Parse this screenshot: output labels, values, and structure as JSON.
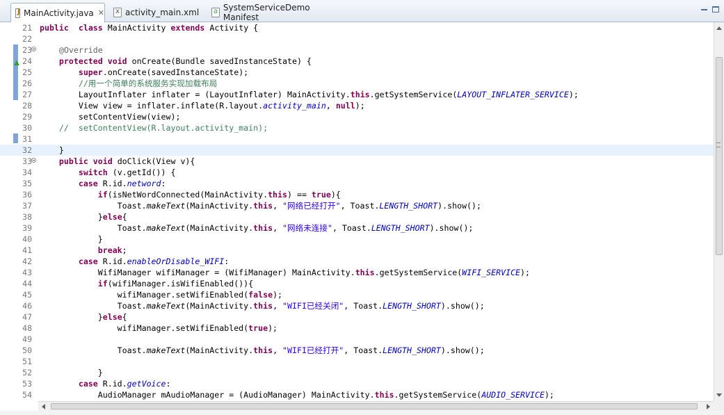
{
  "tabs": [
    {
      "label": "MainActivity.java",
      "icon": "java-file-icon",
      "active": true
    },
    {
      "label": "activity_main.xml",
      "icon": "xml-file-icon",
      "active": false
    },
    {
      "label": "SystemServiceDemo Manifest",
      "icon": "manifest-file-icon",
      "active": false
    }
  ],
  "editor": {
    "current_line": 32,
    "lines": [
      {
        "n": "21",
        "fold": false,
        "segments": [
          [
            "kw",
            "public"
          ],
          [
            "",
            "  "
          ],
          [
            "kw",
            "class"
          ],
          [
            "",
            " MainActivity "
          ],
          [
            "kw",
            "extends"
          ],
          [
            "",
            " Activity {"
          ]
        ]
      },
      {
        "n": "22",
        "fold": false,
        "segments": []
      },
      {
        "n": "23",
        "fold": true,
        "segments": [
          [
            "",
            "    "
          ],
          [
            "ann",
            "@Override"
          ]
        ]
      },
      {
        "n": "24",
        "fold": false,
        "segments": [
          [
            "",
            "    "
          ],
          [
            "kw",
            "protected"
          ],
          [
            "",
            " "
          ],
          [
            "kw",
            "void"
          ],
          [
            "",
            " onCreate(Bundle savedInstanceState) {"
          ]
        ]
      },
      {
        "n": "25",
        "fold": false,
        "segments": [
          [
            "",
            "        "
          ],
          [
            "kw",
            "super"
          ],
          [
            "",
            ".onCreate(savedInstanceState);"
          ]
        ]
      },
      {
        "n": "26",
        "fold": false,
        "segments": [
          [
            "",
            "        "
          ],
          [
            "cm",
            "//用一个简单的系统服务实现加载布局"
          ]
        ]
      },
      {
        "n": "27",
        "fold": false,
        "segments": [
          [
            "",
            "        LayoutInflater inflater = (LayoutInflater) MainActivity."
          ],
          [
            "kw",
            "this"
          ],
          [
            "",
            ".getSystemService("
          ],
          [
            "sf",
            "LAYOUT_INFLATER_SERVICE"
          ],
          [
            "",
            ");"
          ]
        ]
      },
      {
        "n": "28",
        "fold": false,
        "segments": [
          [
            "",
            "        View view = inflater.inflate(R.layout."
          ],
          [
            "sf",
            "activity_main"
          ],
          [
            "",
            ", "
          ],
          [
            "kw",
            "null"
          ],
          [
            "",
            ");"
          ]
        ]
      },
      {
        "n": "29",
        "fold": false,
        "segments": [
          [
            "",
            "        setContentView(view);"
          ]
        ]
      },
      {
        "n": "30",
        "fold": false,
        "segments": [
          [
            "cm",
            "    //  setContentView(R.layout.activity_main);"
          ]
        ]
      },
      {
        "n": "31",
        "fold": false,
        "segments": []
      },
      {
        "n": "32",
        "fold": false,
        "segments": [
          [
            "",
            "    }"
          ]
        ]
      },
      {
        "n": "33",
        "fold": true,
        "segments": [
          [
            "",
            "    "
          ],
          [
            "kw",
            "public"
          ],
          [
            "",
            " "
          ],
          [
            "kw",
            "void"
          ],
          [
            "",
            " doClick(View v){"
          ]
        ]
      },
      {
        "n": "34",
        "fold": false,
        "segments": [
          [
            "",
            "        "
          ],
          [
            "kw",
            "switch"
          ],
          [
            "",
            " (v.getId()) {"
          ]
        ]
      },
      {
        "n": "35",
        "fold": false,
        "segments": [
          [
            "",
            "        "
          ],
          [
            "kw",
            "case"
          ],
          [
            "",
            " R.id."
          ],
          [
            "sf",
            "netword"
          ],
          [
            "",
            ":"
          ]
        ]
      },
      {
        "n": "36",
        "fold": false,
        "segments": [
          [
            "",
            "            "
          ],
          [
            "kw",
            "if"
          ],
          [
            "",
            "(isNetWordConnected(MainActivity."
          ],
          [
            "kw",
            "this"
          ],
          [
            "",
            ") == "
          ],
          [
            "kw",
            "true"
          ],
          [
            "",
            "){"
          ]
        ]
      },
      {
        "n": "37",
        "fold": false,
        "segments": [
          [
            "",
            "                Toast."
          ],
          [
            "it",
            "makeText"
          ],
          [
            "",
            "(MainActivity."
          ],
          [
            "kw",
            "this"
          ],
          [
            "",
            ", "
          ],
          [
            "st",
            "\"网络已经打开\""
          ],
          [
            "",
            ", Toast."
          ],
          [
            "sf",
            "LENGTH_SHORT"
          ],
          [
            "",
            ").show();"
          ]
        ]
      },
      {
        "n": "38",
        "fold": false,
        "segments": [
          [
            "",
            "            }"
          ],
          [
            "kw",
            "else"
          ],
          [
            "",
            "{"
          ]
        ]
      },
      {
        "n": "39",
        "fold": false,
        "segments": [
          [
            "",
            "                Toast."
          ],
          [
            "it",
            "makeText"
          ],
          [
            "",
            "(MainActivity."
          ],
          [
            "kw",
            "this"
          ],
          [
            "",
            ", "
          ],
          [
            "st",
            "\"网络未连接\""
          ],
          [
            "",
            ", Toast."
          ],
          [
            "sf",
            "LENGTH_SHORT"
          ],
          [
            "",
            ").show();"
          ]
        ]
      },
      {
        "n": "40",
        "fold": false,
        "segments": [
          [
            "",
            "            }"
          ]
        ]
      },
      {
        "n": "41",
        "fold": false,
        "segments": [
          [
            "",
            "            "
          ],
          [
            "kw",
            "break"
          ],
          [
            "",
            ";"
          ]
        ]
      },
      {
        "n": "42",
        "fold": false,
        "segments": [
          [
            "",
            "        "
          ],
          [
            "kw",
            "case"
          ],
          [
            "",
            " R.id."
          ],
          [
            "sf",
            "enableOrDisable_WIFI"
          ],
          [
            "",
            ":"
          ]
        ]
      },
      {
        "n": "43",
        "fold": false,
        "segments": [
          [
            "",
            "            WifiManager wifiManager = (WifiManager) MainActivity."
          ],
          [
            "kw",
            "this"
          ],
          [
            "",
            ".getSystemService("
          ],
          [
            "sf",
            "WIFI_SERVICE"
          ],
          [
            "",
            ");"
          ]
        ]
      },
      {
        "n": "44",
        "fold": false,
        "segments": [
          [
            "",
            "            "
          ],
          [
            "kw",
            "if"
          ],
          [
            "",
            "(wifiManager.isWifiEnabled()){"
          ]
        ]
      },
      {
        "n": "45",
        "fold": false,
        "segments": [
          [
            "",
            "                wifiManager.setWifiEnabled("
          ],
          [
            "kw",
            "false"
          ],
          [
            "",
            ");"
          ]
        ]
      },
      {
        "n": "46",
        "fold": false,
        "segments": [
          [
            "",
            "                Toast."
          ],
          [
            "it",
            "makeText"
          ],
          [
            "",
            "(MainActivity."
          ],
          [
            "kw",
            "this"
          ],
          [
            "",
            ", "
          ],
          [
            "st",
            "\"WIFI已经关闭\""
          ],
          [
            "",
            ", Toast."
          ],
          [
            "sf",
            "LENGTH_SHORT"
          ],
          [
            "",
            ").show();"
          ]
        ]
      },
      {
        "n": "47",
        "fold": false,
        "segments": [
          [
            "",
            "            }"
          ],
          [
            "kw",
            "else"
          ],
          [
            "",
            "{"
          ]
        ]
      },
      {
        "n": "48",
        "fold": false,
        "segments": [
          [
            "",
            "                wifiManager.setWifiEnabled("
          ],
          [
            "kw",
            "true"
          ],
          [
            "",
            ");"
          ]
        ]
      },
      {
        "n": "49",
        "fold": false,
        "segments": []
      },
      {
        "n": "50",
        "fold": false,
        "segments": [
          [
            "",
            "                Toast."
          ],
          [
            "it",
            "makeText"
          ],
          [
            "",
            "(MainActivity."
          ],
          [
            "kw",
            "this"
          ],
          [
            "",
            ", "
          ],
          [
            "st",
            "\"WIFI已经打开\""
          ],
          [
            "",
            ", Toast."
          ],
          [
            "sf",
            "LENGTH_SHORT"
          ],
          [
            "",
            ").show();"
          ]
        ]
      },
      {
        "n": "51",
        "fold": false,
        "segments": []
      },
      {
        "n": "52",
        "fold": false,
        "segments": [
          [
            "",
            "            }"
          ]
        ]
      },
      {
        "n": "53",
        "fold": false,
        "segments": [
          [
            "",
            "        "
          ],
          [
            "kw",
            "case"
          ],
          [
            "",
            " R.id."
          ],
          [
            "sf",
            "getVoice"
          ],
          [
            "",
            ":"
          ]
        ]
      },
      {
        "n": "54",
        "fold": false,
        "segments": [
          [
            "",
            "            AudioManager mAudioManager = (AudioManager) MainActivity."
          ],
          [
            "kw",
            "this"
          ],
          [
            "",
            ".getSystemService("
          ],
          [
            "sf",
            "AUDIO_SERVICE"
          ],
          [
            "",
            ");"
          ]
        ]
      }
    ]
  }
}
